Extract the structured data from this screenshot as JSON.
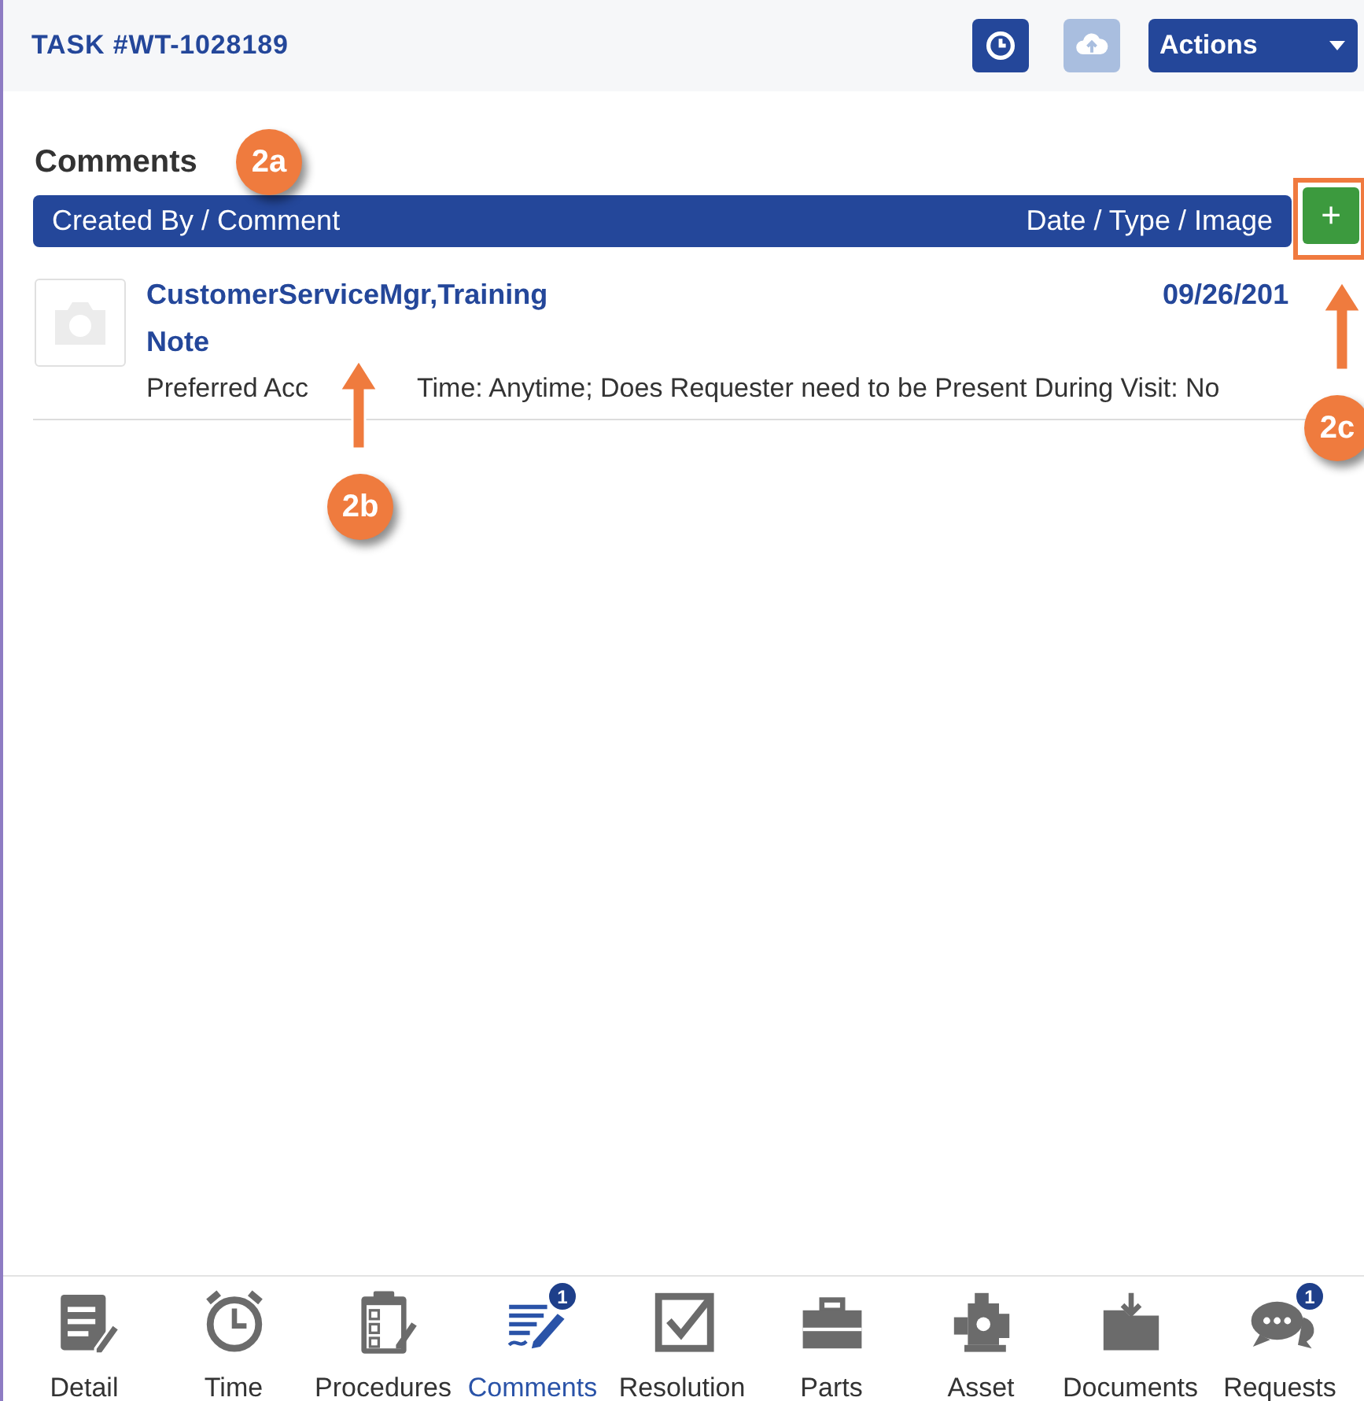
{
  "header": {
    "title": "TASK #WT-1028189",
    "buttons": [
      {
        "kind": "history",
        "disabled": false
      },
      {
        "kind": "upload",
        "disabled": true
      }
    ],
    "actions": {
      "label": "Actions"
    }
  },
  "section": {
    "title": "Comments"
  },
  "table": {
    "columns": [
      "Created By / Comment",
      "Date / Type / Image"
    ],
    "add_button": {
      "label": "+"
    }
  },
  "comments": [
    {
      "author": "CustomerServiceMgr,Training",
      "type": "Note",
      "date": "09/26/201",
      "text_parts": [
        "Preferred Acc",
        "Time: Anytime; Does Requester need to be Present During Visit: No"
      ]
    }
  ],
  "annotations": [
    {
      "label": "2a"
    },
    {
      "label": "2b"
    },
    {
      "label": "2c"
    }
  ],
  "tabs": [
    {
      "label": "Detail",
      "kind": "detail",
      "selected": false
    },
    {
      "label": "Time",
      "kind": "clock",
      "selected": false
    },
    {
      "label": "Procedures",
      "kind": "clipboard",
      "selected": false
    },
    {
      "label": "Comments",
      "kind": "comments",
      "selected": true,
      "badge": "1"
    },
    {
      "label": "Resolution",
      "kind": "check",
      "selected": false
    },
    {
      "label": "Parts",
      "kind": "toolbox",
      "selected": false
    },
    {
      "label": "Asset",
      "kind": "machine",
      "selected": false
    },
    {
      "label": "Documents",
      "kind": "folder",
      "selected": false
    },
    {
      "label": "Requests",
      "kind": "chat",
      "selected": false,
      "badge": "1"
    }
  ]
}
